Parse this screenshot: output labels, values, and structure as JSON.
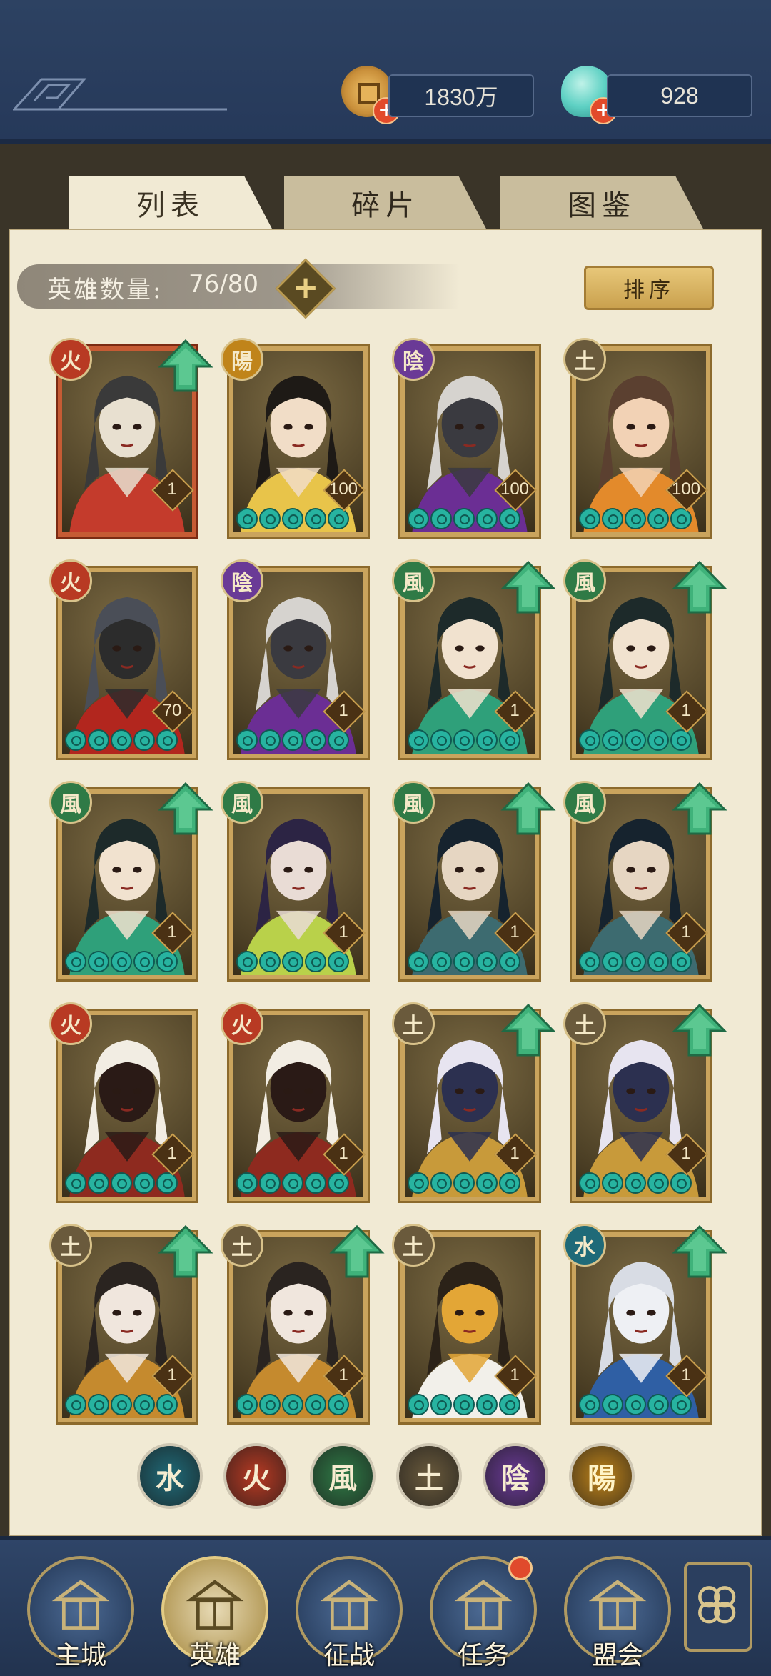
{
  "currency": {
    "coins": {
      "icon": "coin-icon",
      "value": "1830万",
      "color": "#c98f3a"
    },
    "gems": {
      "icon": "shell-gem-icon",
      "value": "928",
      "color": "#5fd1c4"
    }
  },
  "tabs": [
    {
      "label": "列表",
      "active": true
    },
    {
      "label": "碎片",
      "active": false
    },
    {
      "label": "图鉴",
      "active": false
    }
  ],
  "hero_count": {
    "label": "英雄数量:",
    "value": "76/80",
    "add_icon": "plus-icon"
  },
  "sort_label": "排序",
  "element_colors": {
    "火": "#b83a23",
    "陽": "#c0841a",
    "陰": "#6a3a96",
    "土": "#6a5a3c",
    "風": "#2f7a46",
    "水": "#1f6a78"
  },
  "heroes": [
    {
      "element": "火",
      "level": "1",
      "upgrade": true,
      "stars": 0,
      "frame": "red",
      "palette": [
        "#3a3a3a",
        "#c43b2c",
        "#e8e0d0"
      ]
    },
    {
      "element": "陽",
      "level": "100",
      "upgrade": false,
      "stars": 5,
      "frame": "gold",
      "palette": [
        "#1e1a16",
        "#e8c44a",
        "#f1ddc7"
      ]
    },
    {
      "element": "陰",
      "level": "100",
      "upgrade": false,
      "stars": 5,
      "frame": "gold",
      "palette": [
        "#d6d3cf",
        "#6b2e94",
        "#3a3a40"
      ]
    },
    {
      "element": "土",
      "level": "100",
      "upgrade": false,
      "stars": 5,
      "frame": "gold",
      "palette": [
        "#5b4030",
        "#e38a2b",
        "#f2d2b5"
      ]
    },
    {
      "element": "火",
      "level": "70",
      "upgrade": false,
      "stars": 5,
      "frame": "gold",
      "palette": [
        "#4a4e57",
        "#b2261e",
        "#2c2c2c"
      ]
    },
    {
      "element": "陰",
      "level": "1",
      "upgrade": false,
      "stars": 5,
      "frame": "gold",
      "palette": [
        "#d6d3cf",
        "#6b2e94",
        "#3a3a40"
      ]
    },
    {
      "element": "風",
      "level": "1",
      "upgrade": true,
      "stars": 5,
      "frame": "gold",
      "palette": [
        "#1d2a2a",
        "#2fa07a",
        "#f1e2cf"
      ]
    },
    {
      "element": "風",
      "level": "1",
      "upgrade": true,
      "stars": 5,
      "frame": "gold",
      "palette": [
        "#1d2a2a",
        "#2fa07a",
        "#f1e2cf"
      ]
    },
    {
      "element": "風",
      "level": "1",
      "upgrade": true,
      "stars": 5,
      "frame": "gold",
      "palette": [
        "#1d2a2a",
        "#2fa07a",
        "#f1e2cf"
      ]
    },
    {
      "element": "風",
      "level": "1",
      "upgrade": false,
      "stars": 5,
      "frame": "gold",
      "palette": [
        "#2c2444",
        "#b9d14a",
        "#e9dcd5"
      ]
    },
    {
      "element": "風",
      "level": "1",
      "upgrade": true,
      "stars": 5,
      "frame": "gold",
      "palette": [
        "#16232e",
        "#3d6b70",
        "#e6d6c2"
      ]
    },
    {
      "element": "風",
      "level": "1",
      "upgrade": true,
      "stars": 5,
      "frame": "gold",
      "palette": [
        "#16232e",
        "#3d6b70",
        "#e6d6c2"
      ]
    },
    {
      "element": "火",
      "level": "1",
      "upgrade": false,
      "stars": 5,
      "frame": "gold",
      "palette": [
        "#f2ede3",
        "#8e2a1f",
        "#2a1a16"
      ]
    },
    {
      "element": "火",
      "level": "1",
      "upgrade": false,
      "stars": 5,
      "frame": "gold",
      "palette": [
        "#f2ede3",
        "#8e2a1f",
        "#2a1a16"
      ]
    },
    {
      "element": "土",
      "level": "1",
      "upgrade": true,
      "stars": 5,
      "frame": "gold",
      "palette": [
        "#e7e4f0",
        "#c89a3a",
        "#2c3050"
      ]
    },
    {
      "element": "土",
      "level": "1",
      "upgrade": true,
      "stars": 5,
      "frame": "gold",
      "palette": [
        "#e7e4f0",
        "#c89a3a",
        "#2c3050"
      ]
    },
    {
      "element": "土",
      "level": "1",
      "upgrade": true,
      "stars": 5,
      "frame": "gold",
      "palette": [
        "#2a2420",
        "#c58a2e",
        "#f0e6dd"
      ]
    },
    {
      "element": "土",
      "level": "1",
      "upgrade": true,
      "stars": 5,
      "frame": "gold",
      "palette": [
        "#2a2420",
        "#c58a2e",
        "#f0e6dd"
      ]
    },
    {
      "element": "土",
      "level": "1",
      "upgrade": false,
      "stars": 5,
      "frame": "gold",
      "palette": [
        "#2b2218",
        "#f2f0ea",
        "#e3a636"
      ]
    },
    {
      "element": "水",
      "level": "1",
      "upgrade": true,
      "stars": 5,
      "frame": "gold",
      "palette": [
        "#d8dce4",
        "#2f5fa4",
        "#eef0f4"
      ]
    }
  ],
  "filters": [
    {
      "element": "水",
      "name": "water"
    },
    {
      "element": "火",
      "name": "fire"
    },
    {
      "element": "風",
      "name": "wind"
    },
    {
      "element": "土",
      "name": "earth"
    },
    {
      "element": "陰",
      "name": "yin"
    },
    {
      "element": "陽",
      "name": "yang"
    }
  ],
  "nav": [
    {
      "label": "主城",
      "icon": "city-gate-icon",
      "active": false,
      "dot": false
    },
    {
      "label": "英雄",
      "icon": "hero-portrait-icon",
      "active": true,
      "dot": false
    },
    {
      "label": "征战",
      "icon": "campaign-icon",
      "active": false,
      "dot": false
    },
    {
      "label": "任务",
      "icon": "scroll-quest-icon",
      "active": false,
      "dot": true
    },
    {
      "label": "盟会",
      "icon": "alliance-pavilion-icon",
      "active": false,
      "dot": false
    }
  ],
  "more_icon": "more-menu-icon"
}
